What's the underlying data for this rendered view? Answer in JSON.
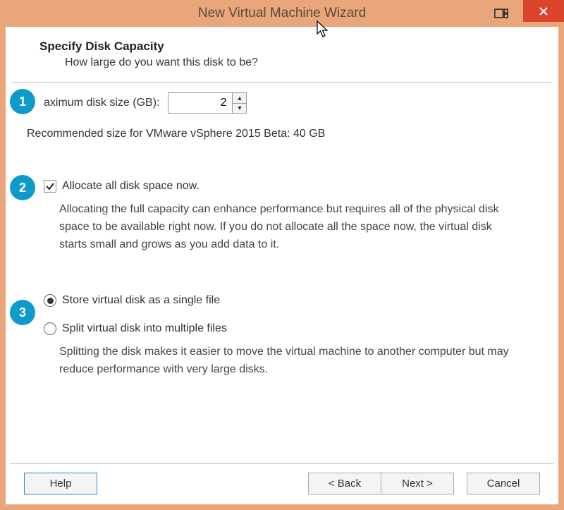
{
  "title": "New Virtual Machine Wizard",
  "header": {
    "title": "Specify Disk Capacity",
    "sub": "How large do you want this disk to be?"
  },
  "disk": {
    "label": "aximum disk size (GB):",
    "value": "2",
    "rec": "Recommended size for VMware vSphere 2015 Beta: 40 GB"
  },
  "alloc": {
    "check_label": "Allocate all disk space now.",
    "desc": "Allocating the full capacity can enhance performance but requires all of the physical disk space to be available right now. If you do not allocate all the space now, the virtual disk starts small and grows as you add data to it."
  },
  "store": {
    "single": "Store virtual disk as a single file",
    "split": "Split virtual disk into multiple files",
    "split_desc": "Splitting the disk makes it easier to move the virtual machine to another computer but may reduce performance with very large disks."
  },
  "badges": {
    "b1": "1",
    "b2": "2",
    "b3": "3"
  },
  "buttons": {
    "help": "Help",
    "back": "< Back",
    "next": "Next >",
    "cancel": "Cancel"
  }
}
